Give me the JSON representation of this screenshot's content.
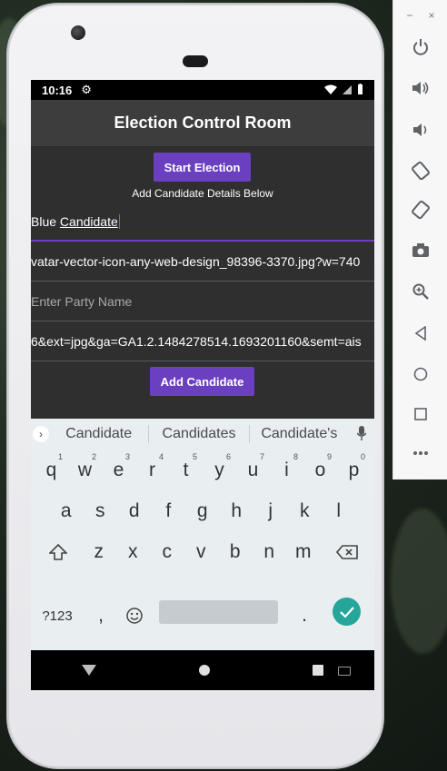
{
  "status_bar": {
    "time": "10:16"
  },
  "app": {
    "title": "Election Control Room",
    "start_button": "Start Election",
    "hint": "Add Candidate Details Below",
    "fields": {
      "candidate_prefix": "Blue ",
      "candidate_underlined": "Candidate",
      "image_url_visible": "vatar-vector-icon-any-web-design_98396-3370.jpg?w=740",
      "party_placeholder": "Enter Party Name",
      "logo_url_visible": "6&ext=jpg&ga=GA1.2.1484278514.1693201160&semt=ais"
    },
    "add_button": "Add Candidate"
  },
  "keyboard": {
    "suggestions": [
      "Candidate",
      "Candidates",
      "Candidate's"
    ],
    "row1": [
      {
        "k": "q",
        "n": "1"
      },
      {
        "k": "w",
        "n": "2"
      },
      {
        "k": "e",
        "n": "3"
      },
      {
        "k": "r",
        "n": "4"
      },
      {
        "k": "t",
        "n": "5"
      },
      {
        "k": "y",
        "n": "6"
      },
      {
        "k": "u",
        "n": "7"
      },
      {
        "k": "i",
        "n": "8"
      },
      {
        "k": "o",
        "n": "9"
      },
      {
        "k": "p",
        "n": "0"
      }
    ],
    "row2": [
      "a",
      "s",
      "d",
      "f",
      "g",
      "h",
      "j",
      "k",
      "l"
    ],
    "row3": [
      "z",
      "x",
      "c",
      "v",
      "b",
      "n",
      "m"
    ],
    "symbols_key": "?123",
    "comma_key": ",",
    "period_key": "."
  },
  "icons": {
    "gear": "gear-icon",
    "wifi": "wifi-icon",
    "signal": "signal-icon",
    "battery": "battery-icon",
    "mic": "mic-icon",
    "shift": "shift-icon",
    "backspace": "backspace-icon",
    "emoji": "emoji-icon",
    "enter": "enter-check-icon"
  },
  "emulator": {
    "minimize": "−",
    "close": "×",
    "tools": [
      "power-icon",
      "volume-up-icon",
      "volume-down-icon",
      "rotate-left-icon",
      "rotate-right-icon",
      "camera-icon",
      "zoom-icon",
      "back-icon",
      "home-icon",
      "overview-icon",
      "more-icon"
    ]
  },
  "colors": {
    "accent": "#6a3fc0",
    "appbar": "#3d3d3d",
    "enter": "#26a69a"
  }
}
